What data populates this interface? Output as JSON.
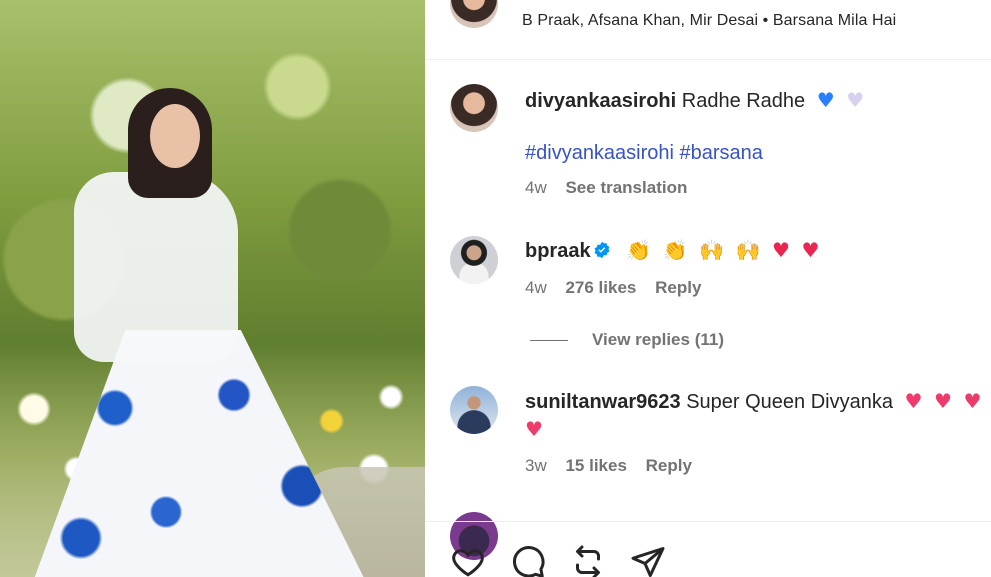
{
  "post": {
    "subtitle": "B Praak, Afsana Khan, Mir Desai • Barsana Mila Hai"
  },
  "comments": [
    {
      "username": "divyankaasirohi",
      "text": "Radhe Radhe",
      "emojis": [
        "♥",
        "♥"
      ],
      "hashtags": "#divyankaasirohi #barsana",
      "time": "4w",
      "translation_label": "See translation"
    },
    {
      "username": "bpraak",
      "verified": true,
      "emojis": [
        "👏",
        "👏",
        "🙌",
        "🙌",
        "♥",
        "♥"
      ],
      "time": "4w",
      "likes": "276 likes",
      "reply_label": "Reply",
      "view_replies_label": "View replies (11)"
    },
    {
      "username": "suniltanwar9623",
      "text": "Super Queen Divyanka",
      "emojis": [
        "♥",
        "♥",
        "♥"
      ],
      "extra_emoji": "♥",
      "time": "3w",
      "likes": "15 likes",
      "reply_label": "Reply"
    }
  ],
  "actions": {
    "like_icon": "heart-icon",
    "comment_icon": "comment-icon",
    "share_icon": "repost-icon",
    "send_icon": "send-icon"
  },
  "colors": {
    "hashtag": "#3753c5",
    "meta_text": "#737373",
    "verified": "#0095f6",
    "heart_red": "#e8264f"
  }
}
